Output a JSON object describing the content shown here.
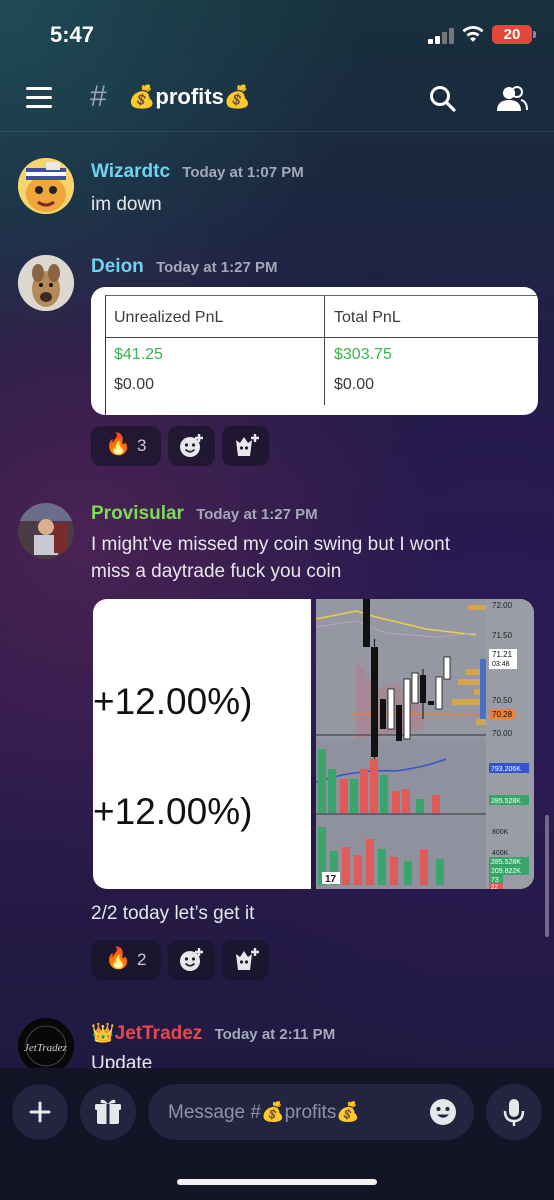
{
  "status_bar": {
    "time": "5:47",
    "battery": "20"
  },
  "header": {
    "hash": "#",
    "channel_name": "💰profits💰"
  },
  "messages": [
    {
      "username": "Wizardtc",
      "username_color": "#6fd3f0",
      "timestamp": "Today at 1:07 PM",
      "text": "im down"
    },
    {
      "username": "Deion",
      "username_color": "#6fd3f0",
      "timestamp": "Today at 1:27 PM",
      "attachment": {
        "headers": [
          "Unrealized PnL",
          "Total PnL"
        ],
        "rows": [
          [
            "$41.25",
            "$303.75"
          ],
          [
            "$0.00",
            "$0.00"
          ]
        ]
      },
      "reactions": [
        {
          "emoji": "🔥",
          "count": "3"
        }
      ]
    },
    {
      "username": "Provisular",
      "username_color": "#7ed957",
      "timestamp": "Today at 1:27 PM",
      "text_line1": "I might’ve missed my coin swing but I wont",
      "text_line2": "miss a daytrade fuck you coin",
      "image_left": [
        "+12.00%)",
        "+12.00%)"
      ],
      "image_right": {
        "prices": [
          "72.00",
          "71.50",
          "71.21",
          "03:48",
          "70.50",
          "70.28",
          "70.00"
        ],
        "volumes": [
          "793.206K",
          "285.528K",
          "800K",
          "400K",
          "285.528K",
          "209.822K",
          "73",
          "22"
        ],
        "badge": "17"
      },
      "caption": "2/2 today let’s get it",
      "reactions": [
        {
          "emoji": "🔥",
          "count": "2"
        }
      ]
    },
    {
      "username": "👑JetTradez",
      "username_color": "#e8474d",
      "timestamp": "Today at 2:11 PM",
      "text": "Update",
      "avatar_text": "JetTradez"
    }
  ],
  "composer": {
    "placeholder": "Message #💰profits💰"
  }
}
